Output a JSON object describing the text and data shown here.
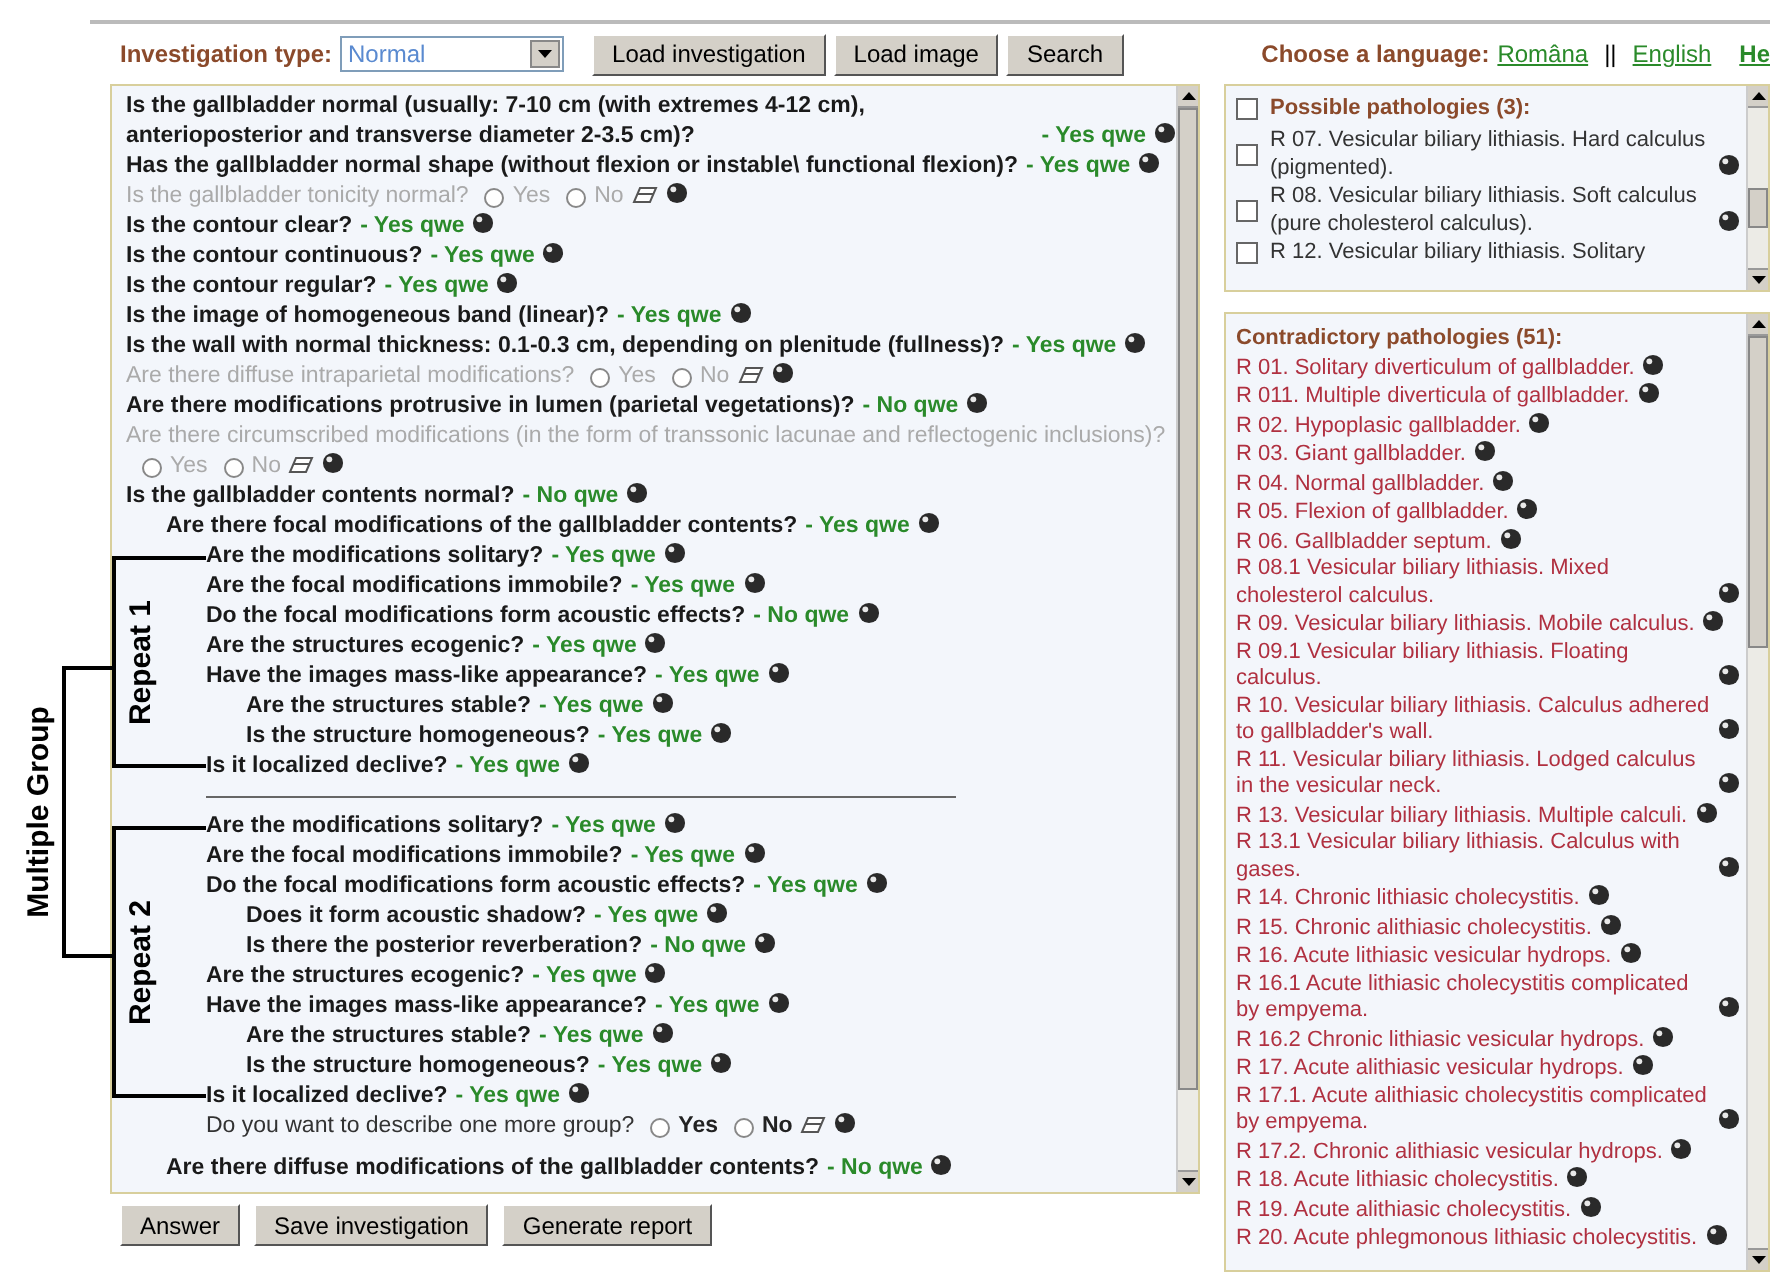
{
  "toolbar": {
    "label": "Investigation type:",
    "value": "Normal",
    "buttons": [
      "Load investigation",
      "Load image",
      "Search"
    ]
  },
  "language": {
    "label": "Choose a language:",
    "options": [
      "Româna",
      "English"
    ],
    "separator": "||",
    "cut_link": "He"
  },
  "questions": [
    {
      "kind": "answered",
      "text": "Is the gallbladder normal (usually: 7-10 cm (with extremes 4-12 cm), anterioposterior and transverse diameter 2-3.5 cm)?",
      "answer": "- Yes qwe"
    },
    {
      "kind": "answered",
      "text": "Has the gallbladder normal shape (without flexion or instable\\ functional flexion)?",
      "answer": "- Yes qwe"
    },
    {
      "kind": "unanswered",
      "text": "Is the gallbladder tonicity normal?",
      "options": [
        {
          "label": "Yes",
          "selected": false
        },
        {
          "label": "No",
          "selected": false
        }
      ]
    },
    {
      "kind": "answered",
      "text": "Is the contour clear?",
      "answer": "- Yes qwe"
    },
    {
      "kind": "answered",
      "text": "Is the contour continuous?",
      "answer": "- Yes qwe"
    },
    {
      "kind": "answered",
      "text": "Is the contour regular?",
      "answer": "- Yes qwe"
    },
    {
      "kind": "answered",
      "text": "Is the image of homogeneous band (linear)?",
      "answer": "- Yes qwe"
    },
    {
      "kind": "answered",
      "text": "Is the wall with normal thickness: 0.1-0.3 cm, depending on plenitude (fullness)?",
      "answer": "- Yes qwe"
    },
    {
      "kind": "unanswered",
      "text": "Are there diffuse intraparietal modifications?",
      "options": [
        {
          "label": "Yes",
          "selected": false
        },
        {
          "label": "No",
          "selected": false
        }
      ]
    },
    {
      "kind": "answered",
      "text": "Are there modifications protrusive in lumen (parietal vegetations)?",
      "answer": "- No qwe"
    },
    {
      "kind": "unanswered",
      "text": "Are there circumscribed modifications (in the form of transsonic lacunae and reflectogenic inclusions)?",
      "options": [
        {
          "label": "Yes",
          "selected": false
        },
        {
          "label": "No",
          "selected": false
        }
      ]
    },
    {
      "kind": "answered",
      "text": "Is the gallbladder contents normal?",
      "answer": "- No qwe",
      "children": [
        {
          "kind": "answered",
          "text": "Are there focal modifications of the gallbladder contents?",
          "answer": "- Yes qwe",
          "children": [
            {
              "kind": "group",
              "label": "Multiple Group",
              "repeats": [
                {
                  "label": "Repeat 1",
                  "items": [
                    {
                      "kind": "answered",
                      "text": "Are the modifications solitary?",
                      "answer": "- Yes qwe"
                    },
                    {
                      "kind": "answered",
                      "text": "Are the focal modifications immobile?",
                      "answer": "- Yes qwe"
                    },
                    {
                      "kind": "answered",
                      "text": "Do the focal modifications form acoustic effects?",
                      "answer": "- No qwe"
                    },
                    {
                      "kind": "answered",
                      "text": "Are the structures ecogenic?",
                      "answer": "- Yes qwe"
                    },
                    {
                      "kind": "answered",
                      "text": "Have the images mass-like appearance?",
                      "answer": "- Yes qwe",
                      "children": [
                        {
                          "kind": "answered",
                          "text": "Are the structures stable?",
                          "answer": "- Yes qwe"
                        },
                        {
                          "kind": "answered",
                          "text": "Is the structure homogeneous?",
                          "answer": "- Yes qwe"
                        }
                      ]
                    },
                    {
                      "kind": "answered",
                      "text": "Is it localized declive?",
                      "answer": "- Yes qwe"
                    }
                  ]
                },
                {
                  "label": "Repeat 2",
                  "items": [
                    {
                      "kind": "answered",
                      "text": "Are the modifications solitary?",
                      "answer": "- Yes qwe"
                    },
                    {
                      "kind": "answered",
                      "text": "Are the focal modifications immobile?",
                      "answer": "- Yes qwe"
                    },
                    {
                      "kind": "answered",
                      "text": "Do the focal modifications form acoustic effects?",
                      "answer": "- Yes qwe",
                      "children": [
                        {
                          "kind": "answered",
                          "text": "Does it form acoustic shadow?",
                          "answer": "- Yes qwe"
                        },
                        {
                          "kind": "answered",
                          "text": "Is there the posterior reverberation?",
                          "answer": "- No qwe"
                        }
                      ]
                    },
                    {
                      "kind": "answered",
                      "text": "Are the structures ecogenic?",
                      "answer": "- Yes qwe"
                    },
                    {
                      "kind": "answered",
                      "text": "Have the images mass-like appearance?",
                      "answer": "- Yes qwe",
                      "children": [
                        {
                          "kind": "answered",
                          "text": "Are the structures stable?",
                          "answer": "- Yes qwe"
                        },
                        {
                          "kind": "answered",
                          "text": "Is the structure homogeneous?",
                          "answer": "- Yes qwe"
                        }
                      ]
                    },
                    {
                      "kind": "answered",
                      "text": "Is it localized declive?",
                      "answer": "- Yes qwe"
                    }
                  ]
                }
              ]
            },
            {
              "kind": "prompt",
              "text": "Do you want to describe one more group?",
              "options": [
                {
                  "label": "Yes",
                  "selected": false
                },
                {
                  "label": "No",
                  "selected": false
                }
              ]
            }
          ]
        },
        {
          "kind": "answered",
          "text": "Are there diffuse modifications of the gallbladder contents?",
          "answer": "- No qwe"
        }
      ]
    }
  ],
  "actions": [
    "Answer",
    "Save investigation",
    "Generate report"
  ],
  "possible": {
    "title": "Possible pathologies (3):",
    "checked": false,
    "items": [
      {
        "text": "R 07. Vesicular biliary lithiasis. Hard calculus (pigmented).",
        "checked": false,
        "info": true
      },
      {
        "text": "R 08. Vesicular biliary lithiasis. Soft calculus (pure cholesterol calculus).",
        "checked": false,
        "info": true
      },
      {
        "text": "R 12. Vesicular biliary lithiasis. Solitary",
        "checked": false,
        "info": false
      }
    ]
  },
  "contradictory": {
    "title": "Contradictory pathologies (51):",
    "items": [
      "R 01. Solitary diverticulum of gallbladder.",
      "R 011. Multiple diverticula of gallbladder.",
      "R 02. Hypoplasic gallbladder.",
      "R 03. Giant gallbladder.",
      "R 04. Normal gallbladder.",
      "R 05. Flexion of gallbladder.",
      "R 06. Gallbladder septum.",
      "R 08.1 Vesicular biliary lithiasis. Mixed cholesterol calculus.",
      "R 09. Vesicular biliary lithiasis. Mobile calculus.",
      "R 09.1 Vesicular biliary lithiasis. Floating calculus.",
      "R 10. Vesicular biliary lithiasis. Calculus adhered to gallbladder's wall.",
      "R 11. Vesicular biliary lithiasis. Lodged calculus in the vesicular neck.",
      "R 13. Vesicular biliary lithiasis. Multiple calculi.",
      "R 13.1 Vesicular biliary lithiasis. Calculus with gases.",
      "R 14. Chronic lithiasic cholecystitis.",
      "R 15. Chronic alithiasic cholecystitis.",
      "R 16. Acute lithiasic vesicular hydrops.",
      "R 16.1 Acute lithiasic cholecystitis complicated by empyema.",
      "R 16.2 Chronic lithiasic vesicular hydrops.",
      "R 17. Acute alithiasic vesicular hydrops.",
      "R 17.1. Acute alithiasic cholecystitis complicated by empyema.",
      "R 17.2. Chronic alithiasic vesicular hydrops.",
      "R 18. Acute lithiasic cholecystitis.",
      "R 19. Acute alithiasic cholecystitis.",
      "R 20. Acute phlegmonous lithiasic cholecystitis."
    ]
  }
}
